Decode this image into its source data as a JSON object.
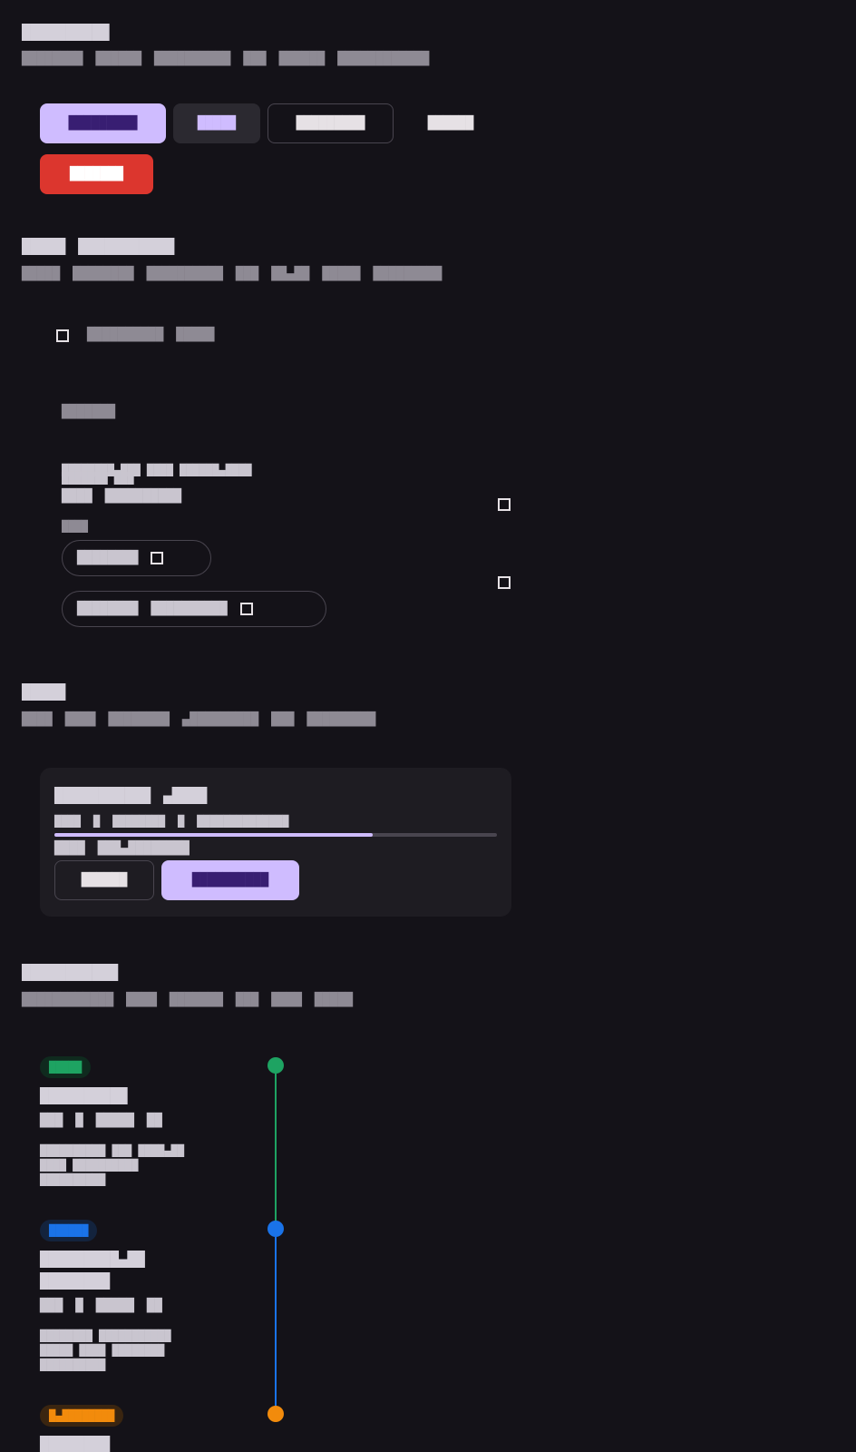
{
  "colors": {
    "background": "#141218",
    "primary": "#cfbcff",
    "on_primary": "#381e72",
    "danger": "#dc362e",
    "success": "#1ea362",
    "info": "#1a73e8",
    "warning": "#f28b0c"
  },
  "buttons_section": {
    "title": "██████████",
    "description_words": [
      "████████",
      "██████",
      "██████████",
      "███",
      "██████",
      "████████████"
    ],
    "filled_label": "█████████",
    "tonal_label": "█████",
    "outlined_label": "█████████",
    "text_label": "██████",
    "danger_label": "███████"
  },
  "toggles_section": {
    "title_words": [
      "█████",
      "███████████"
    ],
    "description_words": [
      "█████",
      "████████",
      "██████████",
      "███",
      "██▄██",
      "█████",
      "█████████"
    ],
    "checkbox_label_words": [
      "██████████",
      "█████"
    ],
    "subheading": "███████",
    "list_item": {
      "line1": "████████▄███  ████  ██████▄████",
      "line1b": "███████ ███",
      "line2_words": [
        "████",
        "██████████"
      ],
      "line3": "████",
      "chip1_label": "████████",
      "chip2_words": [
        "████████",
        "██████████"
      ]
    }
  },
  "dialog_section": {
    "title": "█████",
    "description_words": [
      "████",
      "████",
      "████████",
      "▄█████████",
      "███",
      "█████████"
    ],
    "card": {
      "title_words": [
        "███████████",
        "▄████"
      ],
      "meta_words": [
        "████",
        "█",
        "████████",
        "█",
        "██████████████"
      ],
      "progress": 0.72,
      "footer_words": [
        "████",
        "███▄████████"
      ],
      "secondary_label": "██████",
      "primary_label": "██████████"
    }
  },
  "timeline_section": {
    "title": "███████████",
    "description_words": [
      "████████████",
      "████",
      "███████",
      "███",
      "████",
      "█████"
    ],
    "entries": [
      {
        "badge": "█████",
        "color": "#1ea362",
        "title": "██████████",
        "title2": "",
        "meta_words": [
          "███",
          "█",
          "█████",
          "██"
        ],
        "lines": [
          "██████████  ███  ████▄██",
          "████  ██████████",
          "██████████"
        ]
      },
      {
        "badge": "██████",
        "color": "#1a73e8",
        "title": "█████████▄██",
        "title2": "████████",
        "meta_words": [
          "███",
          "█",
          "█████",
          "██"
        ],
        "lines": [
          "████████  ███████████",
          "█████  ████  ████████",
          "██████████"
        ]
      },
      {
        "badge": "█▄████████",
        "color": "#f28b0c",
        "title": "████████",
        "title2": "",
        "meta_words": [],
        "lines": []
      }
    ]
  }
}
